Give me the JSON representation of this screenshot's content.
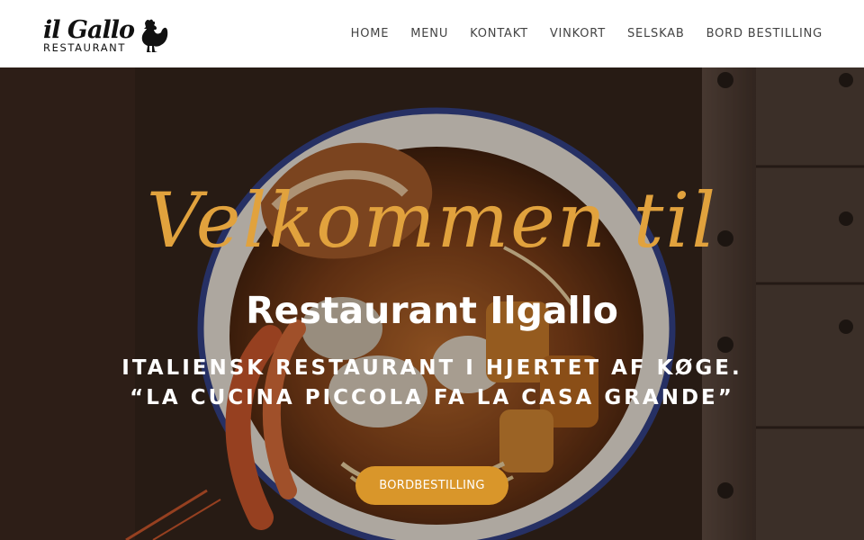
{
  "logo": {
    "script_text": "il Gallo",
    "sub_text": "RESTAURANT",
    "icon": "rooster-icon"
  },
  "nav": {
    "items": [
      {
        "label": "HOME"
      },
      {
        "label": "MENU"
      },
      {
        "label": "KONTAKT"
      },
      {
        "label": "VINKORT"
      },
      {
        "label": "SELSKAB"
      },
      {
        "label": "BORD BESTILLING"
      }
    ]
  },
  "hero": {
    "welcome": "Velkommen til",
    "title": "Restaurant Ilgallo",
    "tagline_line1": "ITALIENSK RESTAURANT I HJERTET AF KØGE.",
    "tagline_line2": "“LA CUCINA PICCOLA FA LA CASA GRANDE”",
    "cta_label": "BORDBESTILLING",
    "accent_color": "#d9962a",
    "script_color": "#e1a23d"
  }
}
